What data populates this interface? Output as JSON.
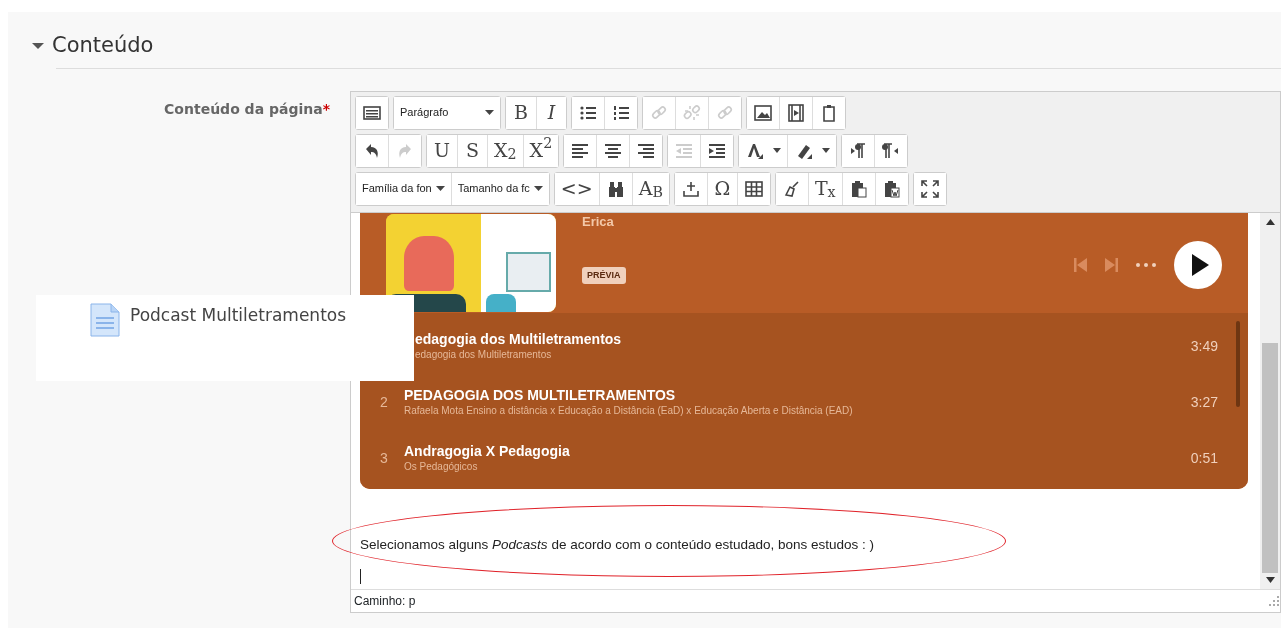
{
  "section": {
    "title": "Conteúdo",
    "expanded": true
  },
  "field": {
    "label": "Conteúdo da página",
    "required_mark": "*"
  },
  "toolbar": [
    [
      [
        {
          "kind": "icon",
          "disabled": false
        }
      ],
      [
        {
          "kind": "select",
          "value": "Parágrafo"
        }
      ],
      [
        {
          "kind": "label",
          "label": "B",
          "disabled": false
        },
        {
          "kind": "label",
          "label": "I",
          "disabled": false
        }
      ],
      [
        {
          "kind": "icon",
          "disabled": false
        },
        {
          "kind": "icon",
          "disabled": false
        }
      ],
      [
        {
          "kind": "icon",
          "disabled": true
        },
        {
          "kind": "icon",
          "disabled": true
        },
        {
          "kind": "icon",
          "disabled": true
        }
      ],
      [
        {
          "kind": "icon",
          "disabled": false
        },
        {
          "kind": "icon",
          "disabled": false
        },
        {
          "kind": "icon",
          "disabled": false
        }
      ]
    ],
    [
      [
        {
          "kind": "icon",
          "disabled": false
        },
        {
          "kind": "icon",
          "disabled": true
        }
      ],
      [
        {
          "kind": "label",
          "label": "U",
          "disabled": false
        },
        {
          "kind": "label",
          "label": "S",
          "disabled": false
        },
        {
          "kind": "label",
          "label": "X$_{2}$",
          "disabled": false
        },
        {
          "kind": "label",
          "label": "X$^{2}$",
          "disabled": false
        }
      ],
      [
        {
          "kind": "icon",
          "disabled": false
        },
        {
          "kind": "icon",
          "disabled": false
        },
        {
          "kind": "icon",
          "disabled": false
        }
      ],
      [
        {
          "kind": "icon",
          "disabled": true
        },
        {
          "kind": "icon",
          "disabled": false
        }
      ],
      [
        {
          "kind": "split",
          "disabled": false
        },
        {
          "kind": "split",
          "disabled": false
        }
      ],
      [
        {
          "kind": "icon",
          "disabled": false
        },
        {
          "kind": "icon",
          "disabled": false
        }
      ]
    ],
    [
      [
        {
          "kind": "select",
          "value": "Família da fon"
        },
        {
          "kind": "select",
          "value": "Tamanho da fc"
        }
      ],
      [
        {
          "kind": "label",
          "label": "<>",
          "disabled": false
        },
        {
          "kind": "icon",
          "disabled": false
        },
        {
          "kind": "label",
          "label": "A$_{B}$",
          "disabled": false
        }
      ],
      [
        {
          "kind": "icon",
          "disabled": false
        },
        {
          "kind": "label",
          "label": "Ω",
          "disabled": false
        },
        {
          "kind": "icon",
          "disabled": false
        }
      ],
      [
        {
          "kind": "icon",
          "disabled": false
        },
        {
          "kind": "label",
          "label": "T$_{x}$",
          "disabled": false
        },
        {
          "kind": "icon",
          "disabled": false
        },
        {
          "kind": "icon",
          "disabled": false
        }
      ],
      [
        {
          "kind": "icon",
          "disabled": false
        }
      ]
    ]
  ],
  "player": {
    "artist": "Erica",
    "badge": "PRÉVIA",
    "tracks": [
      {
        "title": "edagogia dos Multiletramentos",
        "subtitle": "edagogia dos Multiletramentos",
        "duration": "3:49"
      },
      {
        "number": "2",
        "title": "PEDAGOGIA DOS MULTILETRAMENTOS",
        "subtitle": "Rafaela Mota Ensino a distância x Educação a Distância (EaD) x Educação Aberta e Distância (EAD)",
        "duration": "3:27"
      },
      {
        "number": "3",
        "title": "Andragogia X Pedagogia",
        "subtitle": "Os Pedagógicos",
        "duration": "0:51"
      }
    ]
  },
  "content": {
    "text": "Selecionamos alguns *Podcasts* de acordo com o conteúdo estudado, bons estudos : )"
  },
  "status_bar": {
    "path": "Caminho: p"
  },
  "overlay": {
    "title": "Podcast Multiletramentos"
  }
}
